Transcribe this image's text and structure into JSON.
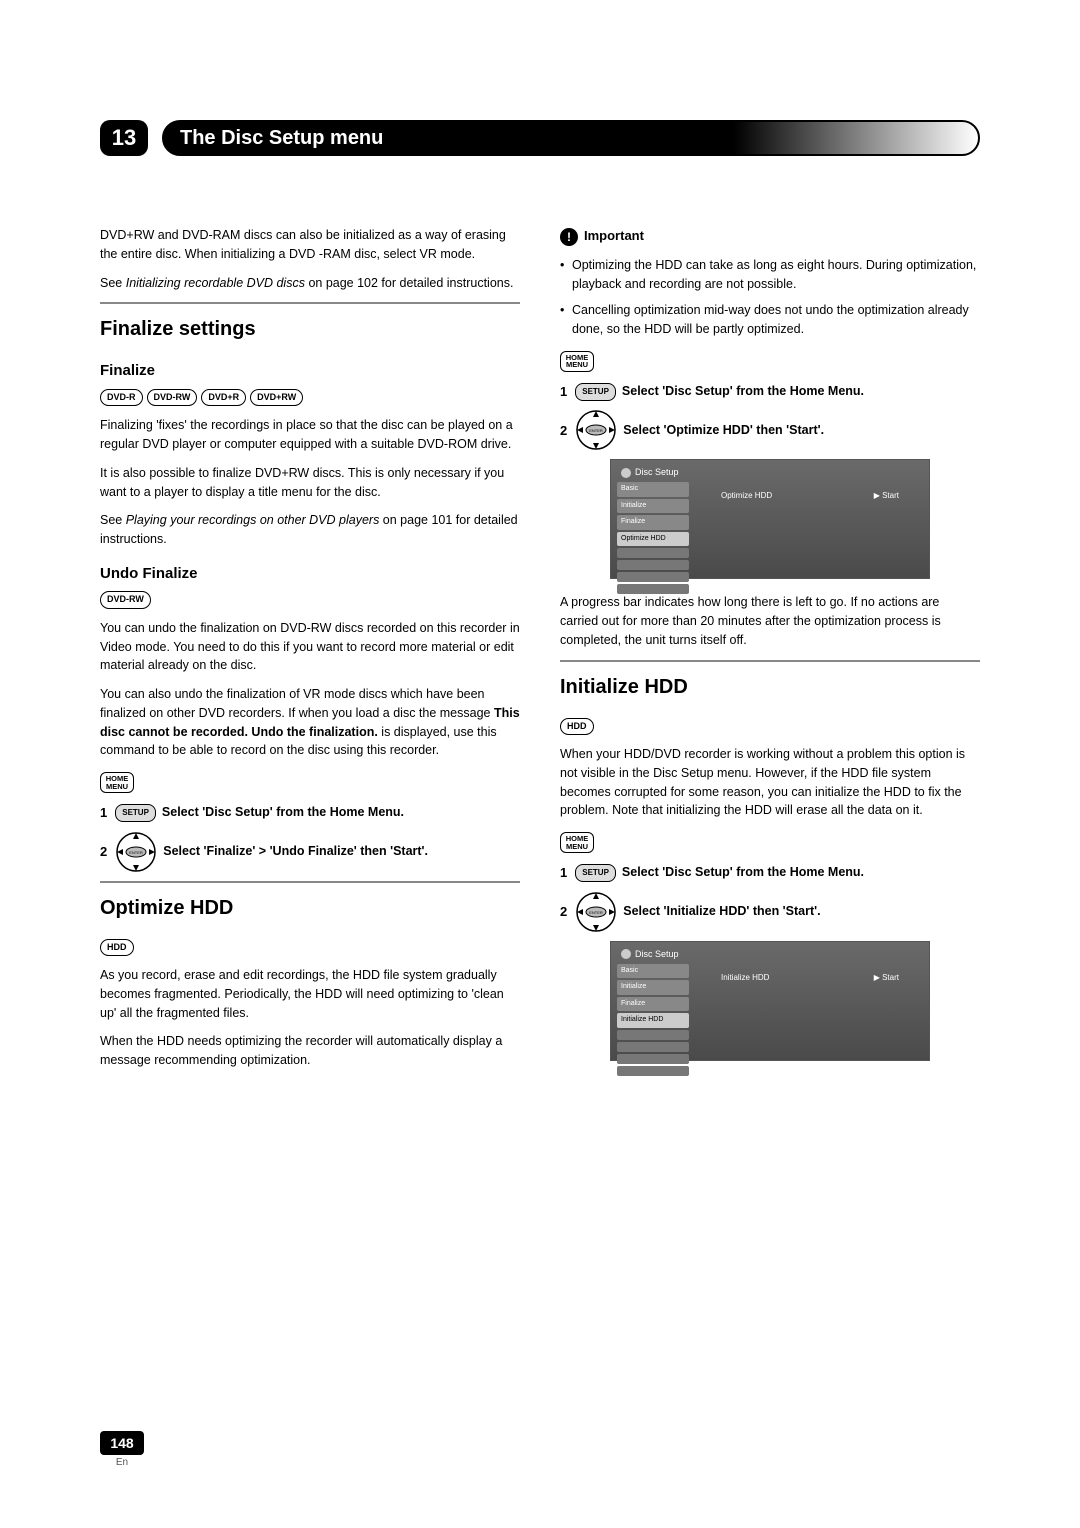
{
  "chapter": {
    "num": "13",
    "title": "The Disc Setup menu"
  },
  "page": {
    "num": "148",
    "lang": "En"
  },
  "left": {
    "intro_p1": "DVD+RW and DVD-RAM discs can also be initialized as a way of erasing the entire disc. When initializing a DVD -RAM disc, select VR mode.",
    "intro_p2a": "See ",
    "intro_p2_i": "Initializing recordable DVD discs",
    "intro_p2b": " on page 102 for detailed instructions.",
    "finalize_settings": "Finalize settings",
    "finalize_h": "Finalize",
    "formats1": [
      "DVD-R",
      "DVD-RW",
      "DVD+R",
      "DVD+RW"
    ],
    "finalize_p1": "Finalizing 'fixes' the recordings in place so that the disc can be played on a regular DVD player or computer equipped with a suitable DVD-ROM drive.",
    "finalize_p2": "It is also possible to finalize DVD+RW discs. This is only necessary if you want to a player to display a title menu for the disc.",
    "finalize_p3a": "See ",
    "finalize_p3_i": "Playing your recordings on other DVD players",
    "finalize_p3b": " on page 101 for detailed instructions.",
    "undo_h": "Undo Finalize",
    "formats2": [
      "DVD-RW"
    ],
    "undo_p1": "You can undo the finalization on DVD-RW discs recorded on this recorder in Video mode. You need to do this if you want to record more material or edit material already on the disc.",
    "undo_p2a": "You can also undo the finalization of VR mode discs which have been finalized on other DVD recorders. If when you load a disc the message ",
    "undo_p2_b1": "This disc cannot be recorded. Undo the finalization.",
    "undo_p2b": " is displayed, use this command to be able to record on the disc using this recorder.",
    "home_menu_label": "HOME\nMENU",
    "setup_label": "SETUP",
    "step1_txt": "Select 'Disc Setup' from the Home Menu.",
    "step2_txt": "Select 'Finalize' > 'Undo Finalize' then 'Start'.",
    "optimize_h": "Optimize HDD",
    "hdd_badge": "HDD",
    "optimize_p1": "As you record, erase and edit recordings, the HDD file system gradually becomes fragmented. Periodically, the HDD will need optimizing to 'clean up' all the fragmented files.",
    "optimize_p2": "When the HDD needs optimizing the recorder will automatically display a message recommending optimization."
  },
  "right": {
    "important_label": "Important",
    "imp_b1": "Optimizing the HDD can take as long as eight hours. During optimization, playback and recording are not possible.",
    "imp_b2": "Cancelling optimization mid-way does not undo the optimization already done, so the HDD will be partly optimized.",
    "step1_txt": "Select 'Disc Setup' from the Home Menu.",
    "step2_txt": "Select 'Optimize HDD' then 'Start'.",
    "ss1": {
      "title": "Disc Setup",
      "items": [
        "Basic",
        "Initialize",
        "Finalize",
        "Optimize HDD"
      ],
      "selected": "Optimize HDD",
      "center": "Optimize HDD",
      "right": "▶ Start"
    },
    "progress_p": "A progress bar indicates how long there is left to go. If no actions are carried out for more than 20 minutes after the optimization process is completed, the unit turns itself off.",
    "init_h": "Initialize HDD",
    "init_p1": "When your HDD/DVD recorder is working without a problem this option is not visible in the Disc Setup menu. However, if the HDD file system becomes corrupted for some reason, you can initialize the HDD to fix the problem. Note that initializing the HDD will erase all the data on it.",
    "step1b_txt": "Select 'Disc Setup' from the Home Menu.",
    "step2b_txt": "Select 'Initialize HDD' then 'Start'.",
    "ss2": {
      "title": "Disc Setup",
      "items": [
        "Basic",
        "Initialize",
        "Finalize",
        "Initialize HDD"
      ],
      "selected": "Initialize HDD",
      "center": "Initialize HDD",
      "right": "▶ Start"
    }
  }
}
